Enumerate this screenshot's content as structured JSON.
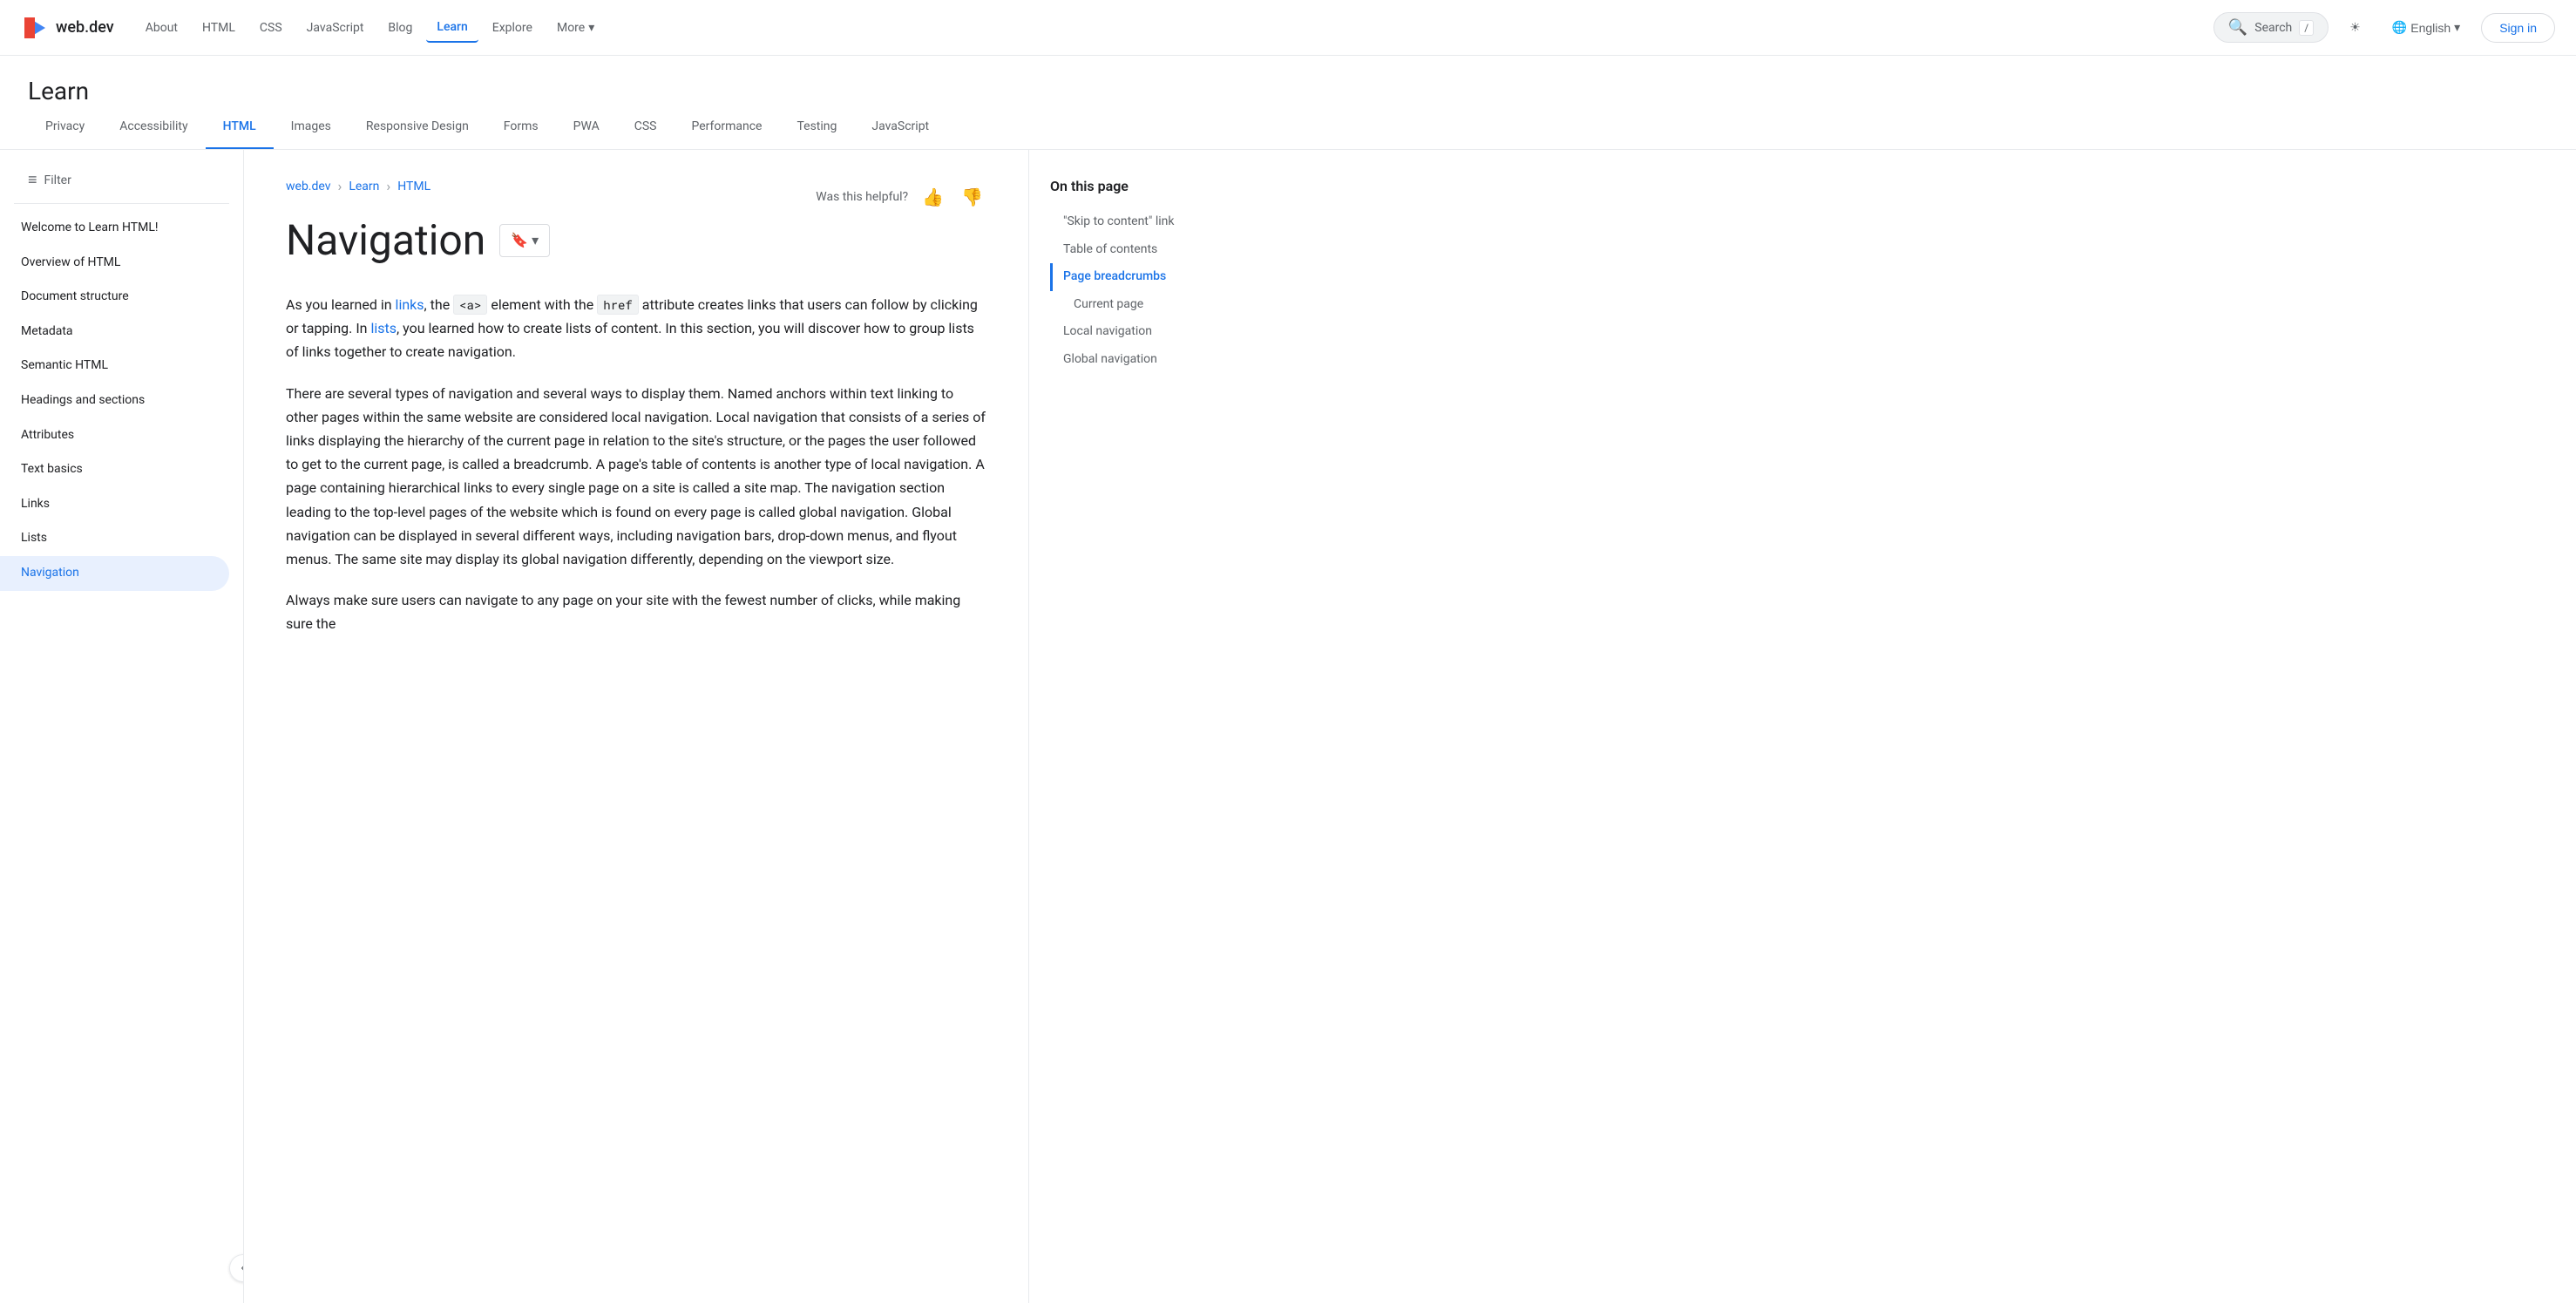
{
  "site": {
    "logo_text": "web.dev",
    "logo_icon": "▶"
  },
  "top_nav": {
    "links": [
      {
        "label": "About",
        "active": false
      },
      {
        "label": "HTML",
        "active": false
      },
      {
        "label": "CSS",
        "active": false
      },
      {
        "label": "JavaScript",
        "active": false
      },
      {
        "label": "Blog",
        "active": false
      },
      {
        "label": "Learn",
        "active": true
      },
      {
        "label": "Explore",
        "active": false
      },
      {
        "label": "More",
        "active": false,
        "has_arrow": true
      }
    ],
    "search_placeholder": "Search",
    "search_shortcut": "/",
    "theme_icon": "☀",
    "lang_label": "English",
    "signin_label": "Sign in"
  },
  "learn_header": {
    "title": "Learn"
  },
  "category_tabs": [
    {
      "label": "Privacy",
      "active": false
    },
    {
      "label": "Accessibility",
      "active": false
    },
    {
      "label": "HTML",
      "active": true
    },
    {
      "label": "Images",
      "active": false
    },
    {
      "label": "Responsive Design",
      "active": false
    },
    {
      "label": "Forms",
      "active": false
    },
    {
      "label": "PWA",
      "active": false
    },
    {
      "label": "CSS",
      "active": false
    },
    {
      "label": "Performance",
      "active": false
    },
    {
      "label": "Testing",
      "active": false
    },
    {
      "label": "JavaScript",
      "active": false
    }
  ],
  "sidebar": {
    "filter_placeholder": "Filter",
    "items": [
      {
        "label": "Welcome to Learn HTML!",
        "active": false
      },
      {
        "label": "Overview of HTML",
        "active": false
      },
      {
        "label": "Document structure",
        "active": false
      },
      {
        "label": "Metadata",
        "active": false
      },
      {
        "label": "Semantic HTML",
        "active": false
      },
      {
        "label": "Headings and sections",
        "active": false
      },
      {
        "label": "Attributes",
        "active": false
      },
      {
        "label": "Text basics",
        "active": false
      },
      {
        "label": "Links",
        "active": false
      },
      {
        "label": "Lists",
        "active": false
      },
      {
        "label": "Navigation",
        "active": true
      }
    ]
  },
  "breadcrumb": {
    "items": [
      {
        "label": "web.dev",
        "link": true
      },
      {
        "label": "Learn",
        "link": true
      },
      {
        "label": "HTML",
        "link": true
      }
    ],
    "separator": "›"
  },
  "helpful": {
    "label": "Was this helpful?"
  },
  "page": {
    "title": "Navigation",
    "bookmark_icon": "🔖",
    "bookmark_arrow": "▾"
  },
  "content": {
    "paragraphs": [
      "As you learned in links, the <a> element with the href attribute creates links that users can follow by clicking or tapping. In lists, you learned how to create lists of content. In this section, you will discover how to group lists of links together to create navigation.",
      "There are several types of navigation and several ways to display them. Named anchors within text linking to other pages within the same website are considered local navigation. Local navigation that consists of a series of links displaying the hierarchy of the current page in relation to the site's structure, or the pages the user followed to get to the current page, is called a breadcrumb. A page's table of contents is another type of local navigation. A page containing hierarchical links to every single page on a site is called a site map. The navigation section leading to the top-level pages of the website which is found on every page is called global navigation. Global navigation can be displayed in several different ways, including navigation bars, drop-down menus, and flyout menus. The same site may display its global navigation differently, depending on the viewport size.",
      "Always make sure users can navigate to any page on your site with the fewest number of clicks, while making sure the"
    ],
    "inline_code": {
      "a_tag": "<a>",
      "href_attr": "href"
    },
    "links_in_text": [
      "links",
      "lists"
    ]
  },
  "toc": {
    "title": "On this page",
    "items": [
      {
        "label": "\"Skip to content\" link",
        "active": false,
        "sub": false
      },
      {
        "label": "Table of contents",
        "active": false,
        "sub": false
      },
      {
        "label": "Page breadcrumbs",
        "active": true,
        "sub": false
      },
      {
        "label": "Current page",
        "active": false,
        "sub": true
      },
      {
        "label": "Local navigation",
        "active": false,
        "sub": false
      },
      {
        "label": "Global navigation",
        "active": false,
        "sub": false
      }
    ]
  }
}
